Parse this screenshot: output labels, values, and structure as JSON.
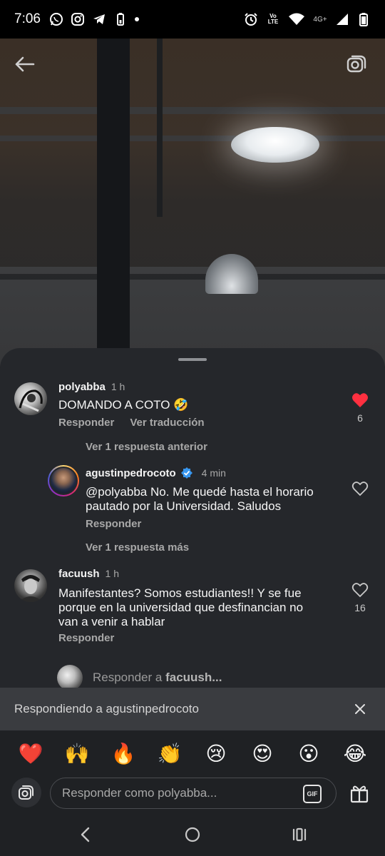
{
  "status_bar": {
    "time": "7:06",
    "network": "4G+",
    "volte": "Vo LTE"
  },
  "video": {
    "back_icon": "arrow-left-icon",
    "camera_icon": "camera-icon"
  },
  "comments": [
    {
      "username": "polyabba",
      "time": "1 h",
      "text": "DOMANDO A COTO 🤣",
      "actions": [
        "Responder",
        "Ver traducción"
      ],
      "liked": true,
      "likes": "6"
    },
    {
      "thread_link_before": "Ver 1 respuesta anterior",
      "username": "agustinpedrocoto",
      "verified": true,
      "time": "4 min",
      "text_line1": "@polyabba No. Me quedé hasta el horario",
      "text_line2": "pautado por la Universidad.  Saludos",
      "actions": [
        "Responder"
      ],
      "liked": false,
      "likes": "",
      "thread_link_after": "Ver 1 respuesta más"
    },
    {
      "username": "facuush",
      "time": "1 h",
      "text_line1": "Manifestantes? Somos estudiantes!! Y se fue",
      "text_line2": "porque en la universidad que desfinancian no",
      "text_line3": "van a venir a hablar",
      "actions": [
        "Responder"
      ],
      "liked": false,
      "likes": "16"
    }
  ],
  "reply_preview": {
    "prefix": "Responder a ",
    "username": "facuush..."
  },
  "replying_bar": {
    "text": "Respondiendo a agustinpedrocoto"
  },
  "emoji_bar": [
    "❤️",
    "🙌",
    "🔥",
    "👏",
    "😢",
    "😍",
    "😮",
    "😂"
  ],
  "composer": {
    "placeholder": "Responder como polyabba...",
    "gif_label": "GIF"
  },
  "colors": {
    "sheet_bg": "#25272b",
    "like_red": "#ff3040",
    "verified_blue": "#3897f0"
  }
}
